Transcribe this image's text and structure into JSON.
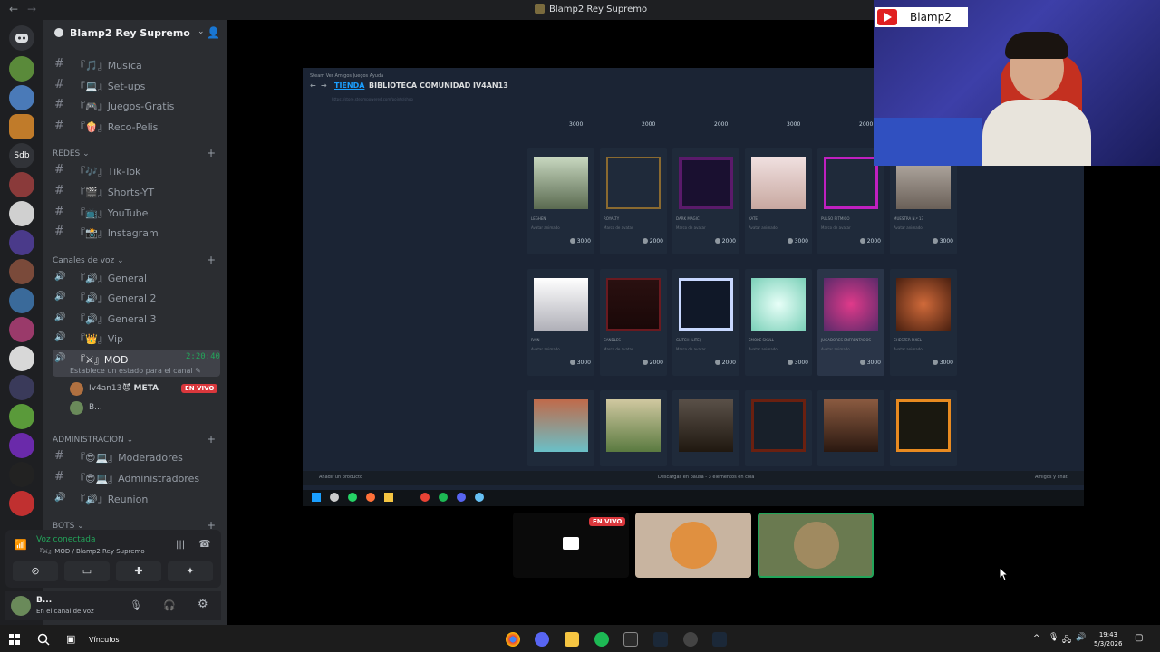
{
  "window": {
    "title": "Blamp2 Rey Supremo"
  },
  "server": {
    "name": "Blamp2 Rey Supremo"
  },
  "channels": {
    "top": [
      {
        "label": "『🎵』Musica"
      },
      {
        "label": "『💻』Set-ups"
      },
      {
        "label": "『🎮』Juegos-Gratis"
      },
      {
        "label": "『🍿』Reco-Pelis"
      }
    ],
    "redes_label": "REDES",
    "redes": [
      {
        "label": "『🎶』Tik-Tok"
      },
      {
        "label": "『🎬』Shorts-YT"
      },
      {
        "label": "『📺』YouTube"
      },
      {
        "label": "『📸』Instagram"
      }
    ],
    "voz_label": "Canales de voz",
    "voz": [
      {
        "label": "『🔊』General"
      },
      {
        "label": "『🔊』General 2"
      },
      {
        "label": "『🔊』General 3"
      },
      {
        "label": "『👑』Vip"
      }
    ],
    "mod": {
      "label": "『⚔』MOD",
      "timer": "2:20:40",
      "status": "Establece un estado para el canal"
    },
    "members": [
      {
        "name": "Iv4an13",
        "tag": "😈 META",
        "live": "EN VIVO"
      },
      {
        "name": "B..."
      }
    ],
    "admin_label": "ADMINISTRACION",
    "admin": [
      {
        "label": "『😎💻』Moderadores"
      },
      {
        "label": "『😎💻』Administradores"
      },
      {
        "label": "『🔊』Reunion"
      }
    ],
    "bots_label": "BOTS"
  },
  "voice": {
    "status": "Voz conectada",
    "channel": "『⚔』MOD / Blamp2 Rey Supremo"
  },
  "user": {
    "name": "B...",
    "status": "En el canal de voz"
  },
  "steam": {
    "menu": "Steam   Ver   Amigos   Juegos   Ayuda",
    "tabs": [
      "TIENDA",
      "BIBLIOTECA",
      "COMUNIDAD",
      "IV4AN13"
    ],
    "url": "https://store.steampowered.com/points/shop",
    "rows": [
      [
        {
          "name": "LEGHEN",
          "type": "Avatar animado",
          "price": "3000"
        },
        {
          "name": "ROYALTY",
          "type": "Marco de avatar",
          "price": "2000"
        },
        {
          "name": "DARK MAGIC",
          "type": "Marco de avatar",
          "price": "2000"
        },
        {
          "name": "KATE",
          "type": "Avatar animado",
          "price": "3000"
        },
        {
          "name": "PULSO RITMICO",
          "type": "Marco de avatar",
          "price": "2000"
        },
        {
          "name": "MUESTRA N.º 13",
          "type": "Avatar animado",
          "price": "3000"
        }
      ],
      [
        {
          "name": "RAIN",
          "type": "Avatar animado",
          "price": "3000"
        },
        {
          "name": "CANDLES",
          "type": "Marco de avatar",
          "price": "2000"
        },
        {
          "name": "GLITCH (LITE)",
          "type": "Marco de avatar",
          "price": "2000"
        },
        {
          "name": "SMOKE SKULL",
          "type": "Avatar animado",
          "price": "3000"
        },
        {
          "name": "JUGADORES ENFRENTADOS",
          "type": "Avatar animado",
          "price": "3000"
        },
        {
          "name": "CHESTER PIXEL",
          "type": "Avatar animado",
          "price": "3000"
        }
      ]
    ],
    "top_prices": [
      "3000",
      "2000",
      "2000",
      "3000",
      "2000"
    ],
    "footer_left": "Añadir un producto",
    "footer_mid": "Descargas en pausa - 3 elementos en cola",
    "footer_right": "Amigos y chat"
  },
  "webcam": {
    "channel": "Blamp2"
  },
  "tiles": {
    "live": "EN VIVO"
  },
  "taskbar": {
    "vinculos": "Vínculos",
    "time": "19:43",
    "date": "5/3/2026"
  },
  "colors": {
    "discord_bg": "#2b2d31",
    "rail": "#1e1f22",
    "green": "#23a55a",
    "live": "#da373c",
    "steam_bg": "#1b2434"
  }
}
